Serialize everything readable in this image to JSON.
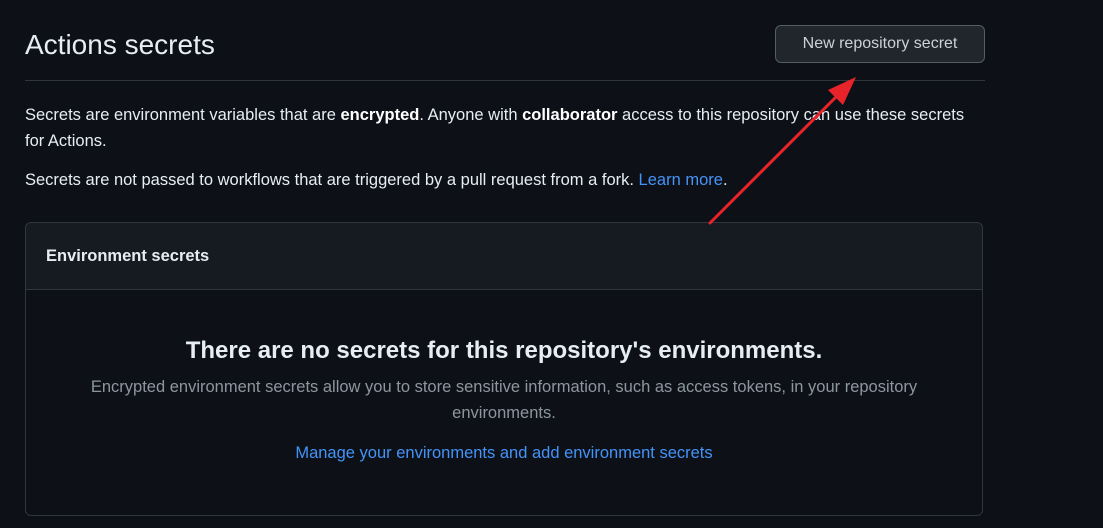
{
  "header": {
    "title": "Actions secrets",
    "new_secret_label": "New repository secret"
  },
  "description": {
    "line1_part1": "Secrets are environment variables that are ",
    "line1_bold1": "encrypted",
    "line1_part2": ". Anyone with ",
    "line1_bold2": "collaborator",
    "line1_part3": " access to this repository can use these secrets for Actions.",
    "line2_text": "Secrets are not passed to workflows that are triggered by a pull request from a fork. ",
    "line2_link": "Learn more",
    "line2_end": "."
  },
  "environment_secrets": {
    "title": "Environment secrets",
    "empty_title": "There are no secrets for this repository's environments.",
    "empty_desc": "Encrypted environment secrets allow you to store sensitive information, such as access tokens, in your repository environments.",
    "manage_link": "Manage your environments and add environment secrets"
  },
  "colors": {
    "background": "#0d1117",
    "accent_link": "#4493f8",
    "annotation_arrow": "#e8232a"
  },
  "annotation": {
    "type": "arrow",
    "points_to": "new-repository-secret-button"
  }
}
